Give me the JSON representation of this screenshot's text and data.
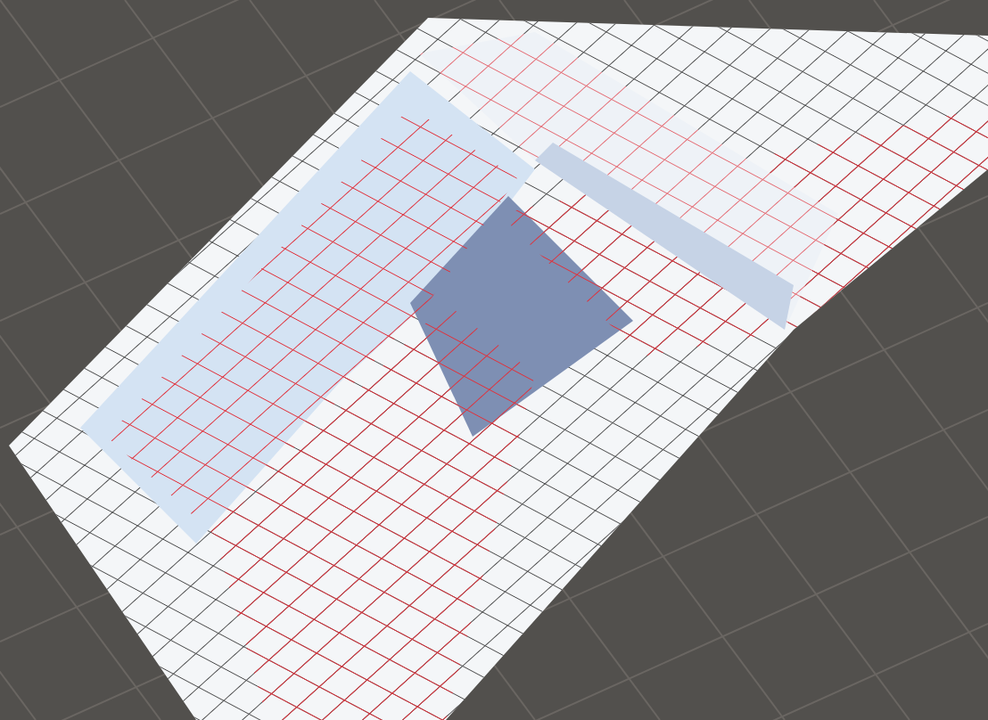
{
  "scene_view": {
    "grid_visible": true
  }
}
